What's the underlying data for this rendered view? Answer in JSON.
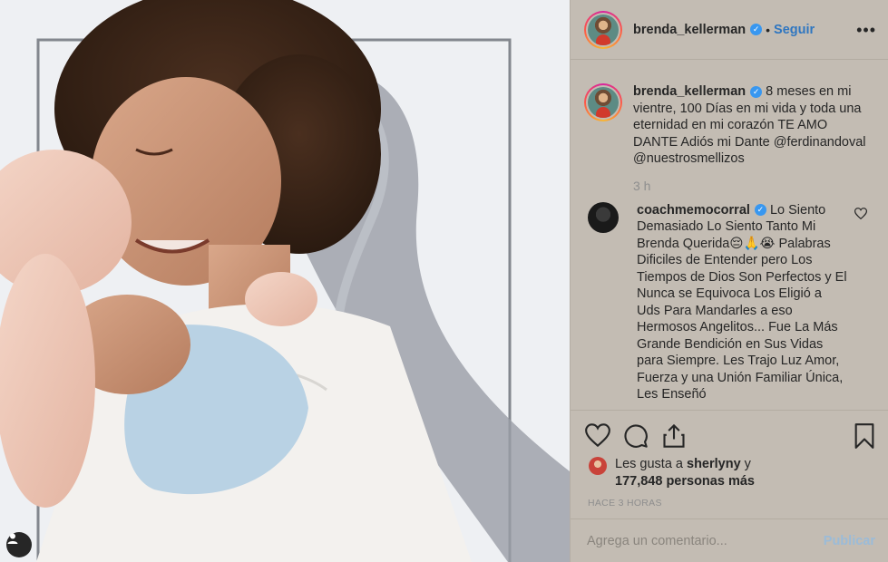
{
  "post": {
    "photo_icon": "user-tag-icon"
  },
  "header": {
    "username": "brenda_kellerman",
    "dot": "•",
    "follow_label": "Seguir",
    "more": "•••"
  },
  "caption": {
    "username": "brenda_kellerman",
    "text": " 8 meses en mi vientre, 100 Días en mi vida y toda una eternidad en mi corazón TE AMO DANTE Adiós mi Dante @ferdinandoval @nuestrosmellizos",
    "time": "3 h"
  },
  "comments": [
    {
      "username": "coachmemocorral",
      "text": " Lo Siento Demasiado Lo Siento Tanto Mi Brenda Querida😔🙏😭 Palabras Dificiles de Entender pero Los Tiempos de Dios Son Perfectos y El Nunca se Equivoca Los Eligió a Uds Para Mandarles a eso Hermosos Angelitos... Fue La Más Grande Bendición en Sus Vidas para Siempre. Les Trajo Luz Amor, Fuerza y una Unión Familiar Única, Les Enseñó"
    }
  ],
  "likes": {
    "prefix": "Les gusta a ",
    "user": "sherlyny",
    "middle": " y",
    "count": "177,848 personas más"
  },
  "posted_ago": "HACE 3 HORAS",
  "add_comment": {
    "placeholder": "Agrega un comentario...",
    "publish_label": "Publicar"
  },
  "colors": {
    "verified": "#3897f0",
    "follow": "#2f76c0",
    "panel_bg": "#c3bcb3"
  }
}
